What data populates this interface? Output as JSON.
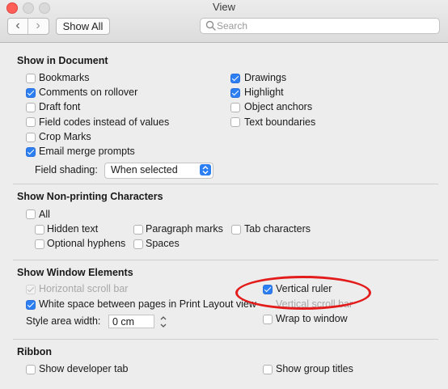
{
  "window": {
    "title": "View",
    "traffic_lights": {
      "close": "#ff5f57",
      "minimize": "#d9d9d9",
      "zoom": "#d9d9d9"
    }
  },
  "toolbar": {
    "back_icon": "chevron-left-icon",
    "forward_icon": "chevron-right-icon",
    "show_all_label": "Show All",
    "search_placeholder": "Search"
  },
  "sections": {
    "show_in_document": {
      "title": "Show in Document",
      "items": [
        {
          "label": "Bookmarks",
          "checked": false
        },
        {
          "label": "Comments on rollover",
          "checked": true
        },
        {
          "label": "Draft font",
          "checked": false
        },
        {
          "label": "Field codes instead of values",
          "checked": false
        },
        {
          "label": "Crop Marks",
          "checked": false
        },
        {
          "label": "Email merge prompts",
          "checked": true
        },
        {
          "label": "Drawings",
          "checked": true
        },
        {
          "label": "Highlight",
          "checked": true
        },
        {
          "label": "Object anchors",
          "checked": false
        },
        {
          "label": "Text boundaries",
          "checked": false
        }
      ],
      "field_shading": {
        "label": "Field shading:",
        "value": "When selected"
      }
    },
    "show_nonprinting": {
      "title": "Show Non-printing Characters",
      "items": [
        {
          "label": "All",
          "checked": false
        },
        {
          "label": "Hidden text",
          "checked": false
        },
        {
          "label": "Paragraph marks",
          "checked": false
        },
        {
          "label": "Tab characters",
          "checked": false
        },
        {
          "label": "Optional hyphens",
          "checked": false
        },
        {
          "label": "Spaces",
          "checked": false
        }
      ]
    },
    "show_window_elements": {
      "title": "Show Window Elements",
      "items": [
        {
          "label": "Horizontal scroll bar",
          "checked": true,
          "disabled": true
        },
        {
          "label": "White space between pages in Print Layout view",
          "checked": true,
          "disabled": false
        },
        {
          "label": "Vertical ruler",
          "checked": true,
          "disabled": false
        },
        {
          "label": "Vertical scroll bar",
          "checked": true,
          "disabled": true
        },
        {
          "label": "Wrap to window",
          "checked": false,
          "disabled": false
        }
      ],
      "style_area": {
        "label": "Style area width:",
        "value": "0 cm"
      }
    },
    "ribbon": {
      "title": "Ribbon",
      "items": [
        {
          "label": "Show developer tab",
          "checked": false
        },
        {
          "label": "Show group titles",
          "checked": false
        }
      ]
    }
  },
  "colors": {
    "accent": "#2c7ff2",
    "annotation": "#e31b1b",
    "panel_bg": "#ededed"
  }
}
